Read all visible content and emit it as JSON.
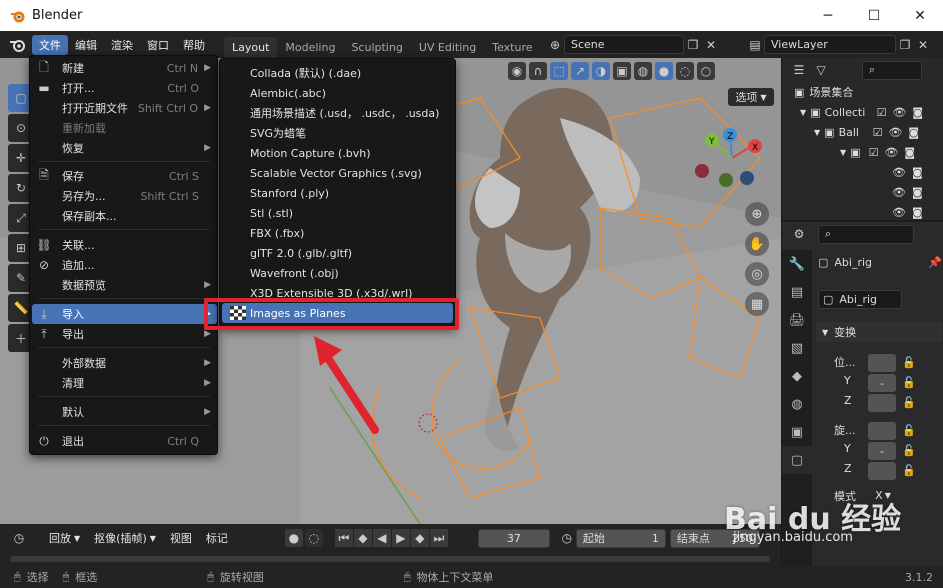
{
  "window": {
    "title": "Blender",
    "minimize": "─",
    "maximize": "☐",
    "close": "✕"
  },
  "menubar": [
    "文件",
    "编辑",
    "渲染",
    "窗口",
    "帮助"
  ],
  "workspaces": [
    "Layout",
    "Modeling",
    "Sculpting",
    "UV Editing",
    "Texture"
  ],
  "scene": "Scene",
  "view_layer": "ViewLayer",
  "viewport": {
    "options_label": "选项"
  },
  "file_menu": [
    {
      "label": "新建",
      "shortcut": "Ctrl N",
      "arrow": true,
      "icon": "new-file-icon"
    },
    {
      "label": "打开...",
      "shortcut": "Ctrl O",
      "icon": "folder-icon"
    },
    {
      "label": "打开近期文件",
      "shortcut": "Shift Ctrl O",
      "arrow": true
    },
    {
      "label": "重新加载",
      "disabled": true
    },
    {
      "label": "恢复",
      "arrow": true
    },
    {
      "label": "保存",
      "shortcut": "Ctrl S",
      "icon": "save-icon"
    },
    {
      "label": "另存为...",
      "shortcut": "Shift Ctrl S"
    },
    {
      "label": "保存副本..."
    },
    {
      "label": "关联...",
      "icon": "link-icon"
    },
    {
      "label": "追加...",
      "icon": "append-icon"
    },
    {
      "label": "数据预览",
      "arrow": true
    },
    {
      "label": "导入",
      "arrow": true,
      "icon": "import-icon",
      "highlight": true
    },
    {
      "label": "导出",
      "arrow": true,
      "icon": "export-icon"
    },
    {
      "label": "外部数据",
      "arrow": true
    },
    {
      "label": "清理",
      "arrow": true
    },
    {
      "label": "默认",
      "arrow": true
    },
    {
      "label": "退出",
      "shortcut": "Ctrl Q",
      "icon": "power-icon"
    }
  ],
  "import_menu": [
    "Collada (默认) (.dae)",
    "Alembic(.abc)",
    "通用场景描述 (.usd， .usdc， .usda)",
    "SVG为蜡笔",
    "Motion Capture (.bvh)",
    "Scalable Vector Graphics (.svg)",
    "Stanford (.ply)",
    "Stl (.stl)",
    "FBX (.fbx)",
    "glTF 2.0 (.glb/.gltf)",
    "Wavefront (.obj)",
    "X3D Extensible 3D (.x3d/.wrl)",
    "Images as Planes"
  ],
  "outliner": {
    "root": "场景集合",
    "rows": [
      "Collecti",
      "Ball",
      "",
      "",
      ""
    ]
  },
  "properties": {
    "object_name": "Abi_rig",
    "data_name": "Abi_rig",
    "panel": "变换",
    "location_label": "位...",
    "rotation_label": "旋...",
    "axis_y": "Y",
    "axis_z": "Z",
    "mode_label": "模式",
    "mode_value": "X",
    "dash": "-"
  },
  "timeline": {
    "playback": "回放",
    "keying": "抠像(插帧)",
    "view": "视图",
    "marker": "标记",
    "current_frame": "37",
    "start_label": "起始",
    "start_value": "1",
    "end_label": "结束点",
    "end_value": "250"
  },
  "status": {
    "select": "选择",
    "box_select": "框选",
    "rotate_view": "旋转视图",
    "context_menu": "物体上下文菜单",
    "version": "3.1.2"
  },
  "watermark": {
    "brand": "Bai du 经验",
    "url": "jingyan.baidu.com"
  },
  "colors": {
    "accent": "#4772b3",
    "highlight_box": "#e0242f",
    "armature": "#ff8a1f"
  }
}
